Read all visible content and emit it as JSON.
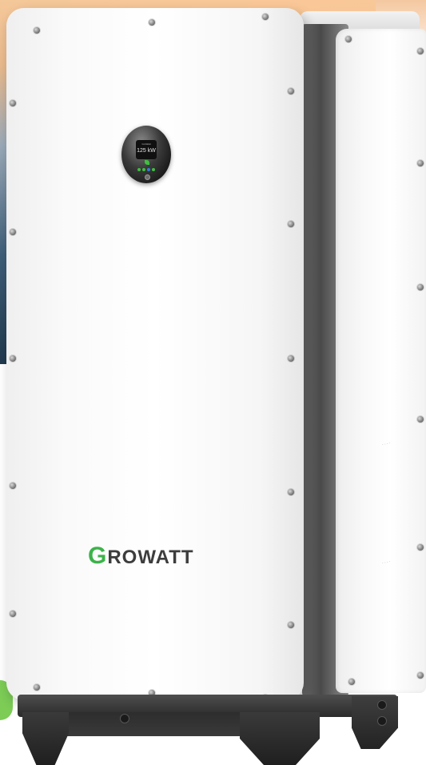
{
  "product": {
    "brand_logo_first": "G",
    "brand_logo_rest": "ROWATT",
    "display_brand": "GroWatt",
    "display_value": "125 kW"
  },
  "colors": {
    "brand_green": "#3cb34a",
    "logo_gray": "#3d3d3d",
    "panel_white": "#ffffff",
    "stand_dark": "#2b2b2b"
  },
  "icons": {
    "display_leaf": "leaf-icon",
    "display_button": "button-icon"
  }
}
